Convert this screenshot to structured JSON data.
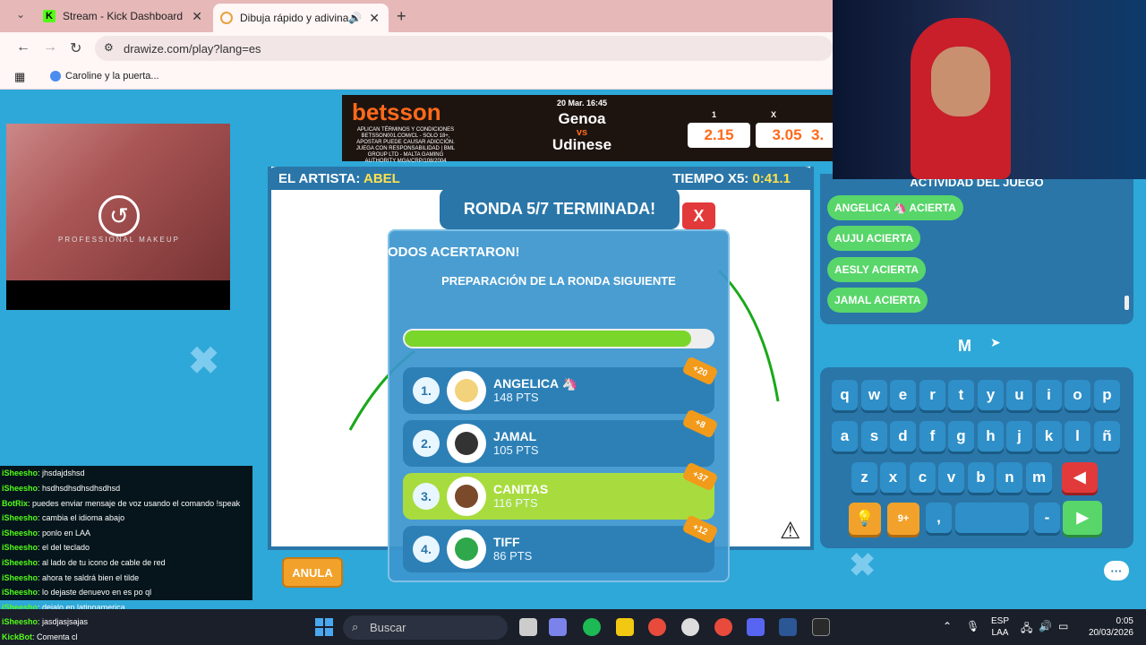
{
  "browser": {
    "tabs": [
      {
        "label": "Stream - Kick Dashboard"
      },
      {
        "label": "Dibuja rápido y adivina"
      }
    ],
    "url": "drawize.com/play?lang=es",
    "bookmark": "Caroline y la puerta..."
  },
  "ad": {
    "brand": "betsson",
    "date": "20 Mar. 16:45",
    "team1": "Genoa",
    "vs": "vs",
    "team2": "Udinese",
    "labels": [
      "1",
      "X"
    ],
    "odds": [
      "2.15",
      "3.05",
      "3."
    ],
    "disclaimer": "APLICAN TÉRMINOS Y CONDICIONES BETSSON001.COM/CL - SOLO 18+, APOSTAR PUEDE CAUSAR ADICCIÓN. JUEGA CON RESPONSABILIDAD | BML GROUP LTD - MALTA GAMING AUTHORITY MGA/CRP/108/2004"
  },
  "video": {
    "brand": "PROFESSIONAL MAKEUP"
  },
  "game": {
    "artist_label": "EL ARTISTA:",
    "artist": "ABEL",
    "time_label": "TIEMPO X5:",
    "time": "0:41.1",
    "round_title": "RONDA 5/7 TERMINADA!",
    "close": "X",
    "all_guessed": "ODOS ACERTARON!",
    "prep": "PREPARACIÓN DE LA RONDA SIGUIENTE",
    "progress": 0.93,
    "players": [
      {
        "rank": "1.",
        "name": "ANGELICA 🦄",
        "pts": "148 PTS",
        "bonus": "+20"
      },
      {
        "rank": "2.",
        "name": "JAMAL",
        "pts": "105 PTS",
        "bonus": "+8"
      },
      {
        "rank": "3.",
        "name": "CANITAS",
        "pts": "116 PTS",
        "bonus": "+37"
      },
      {
        "rank": "4.",
        "name": "TIFF",
        "pts": "86 PTS",
        "bonus": "+12"
      }
    ],
    "anula": "ANULA"
  },
  "activity": {
    "title": "ACTIVIDAD DEL JUEGO",
    "items": [
      "ANGELICA 🦄 ACIERTA",
      "AUJU ACIERTA",
      "AESLY ACIERTA",
      "JAMAL ACIERTA"
    ],
    "letter": "M"
  },
  "keyboard": {
    "row1": [
      "q",
      "w",
      "e",
      "r",
      "t",
      "y",
      "u",
      "i",
      "o",
      "p"
    ],
    "row2": [
      "a",
      "s",
      "d",
      "f",
      "g",
      "h",
      "j",
      "k",
      "l",
      "ñ"
    ],
    "row3": [
      "z",
      "x",
      "c",
      "v",
      "b",
      "n",
      "m"
    ],
    "comma": ",",
    "dash": "-",
    "hint": "9+"
  },
  "chat": [
    {
      "user": "iSheesho",
      "msg": ": jhsdajdshsd"
    },
    {
      "user": "iSheesho",
      "msg": ": hsdhsdhsdhsdhsdhsd"
    },
    {
      "user": "BotRix",
      "msg": ": puedes enviar mensaje de voz usando el comando !speak"
    },
    {
      "user": "iSheesho",
      "msg": ": cambia el idioma abajo"
    },
    {
      "user": "iSheesho",
      "msg": ": ponlo en LAA"
    },
    {
      "user": "iSheesho",
      "msg": ": el del teclado"
    },
    {
      "user": "iSheesho",
      "msg": ": al lado de tu icono de cable de red"
    },
    {
      "user": "iSheesho",
      "msg": ": ahora te saldrá bien el tilde"
    },
    {
      "user": "iSheesho",
      "msg": ": lo dejaste denuevo en es po ql"
    },
    {
      "user": "iSheesho",
      "msg": ": dejalo en latinoamerica"
    },
    {
      "user": "iSheesho",
      "msg": ": jasdjasjsajas"
    },
    {
      "user": "KickBot",
      "msg": ": Comenta cl"
    }
  ],
  "taskbar": {
    "search": "Buscar",
    "lang1": "ESP",
    "lang2": "LAA",
    "time": "0:05",
    "date": "20/03/2026"
  }
}
